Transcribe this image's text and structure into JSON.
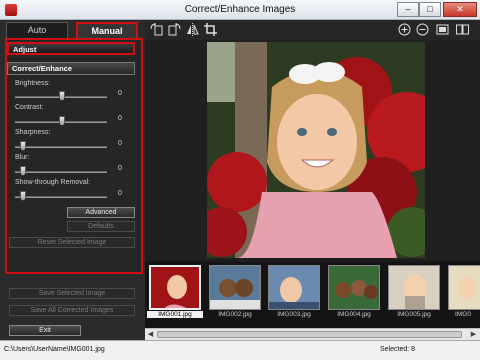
{
  "window": {
    "title": "Correct/Enhance Images",
    "minimize": "–",
    "maximize": "□",
    "close": "✕"
  },
  "tabs": {
    "auto": "Auto",
    "manual": "Manual"
  },
  "sections": {
    "adjust": "Adjust",
    "correct_enhance": "Correct/Enhance"
  },
  "sliders": [
    {
      "label": "Brightness:",
      "value": "0",
      "level": 0.5
    },
    {
      "label": "Contrast:",
      "value": "0",
      "level": 0.5
    },
    {
      "label": "Sharpness:",
      "value": "0",
      "level": 0.0
    },
    {
      "label": "Blur:",
      "value": "0",
      "level": 0.0
    },
    {
      "label": "Show-through Removal:",
      "value": "0",
      "level": 0.0
    }
  ],
  "buttons": {
    "advanced": "Advanced",
    "defaults": "Defaults",
    "reset": "Reset Selected Image",
    "save_selected": "Save Selected Image",
    "save_all": "Save All Corrected Images",
    "exit": "Exit"
  },
  "toolbar_icons": [
    "rotate-left-icon",
    "rotate-right-icon",
    "flip-icon",
    "crop-icon",
    "zoom-in-icon",
    "zoom-out-icon",
    "full-screen-icon",
    "compare-icon"
  ],
  "thumbnails": [
    {
      "name": "IMG001.jpg",
      "selected": true
    },
    {
      "name": "IMG002.jpg",
      "selected": false
    },
    {
      "name": "IMG003.jpg",
      "selected": false
    },
    {
      "name": "IMG004.jpg",
      "selected": false
    },
    {
      "name": "IMG005.jpg",
      "selected": false
    },
    {
      "name": "IMG0",
      "selected": false
    }
  ],
  "status": {
    "path": "C:\\Users\\UserName\\IMG001.jpg",
    "selected": "Selected: 8"
  },
  "colors": {
    "accent_red": "#d01010",
    "panel_bg": "#2b2b2b"
  }
}
